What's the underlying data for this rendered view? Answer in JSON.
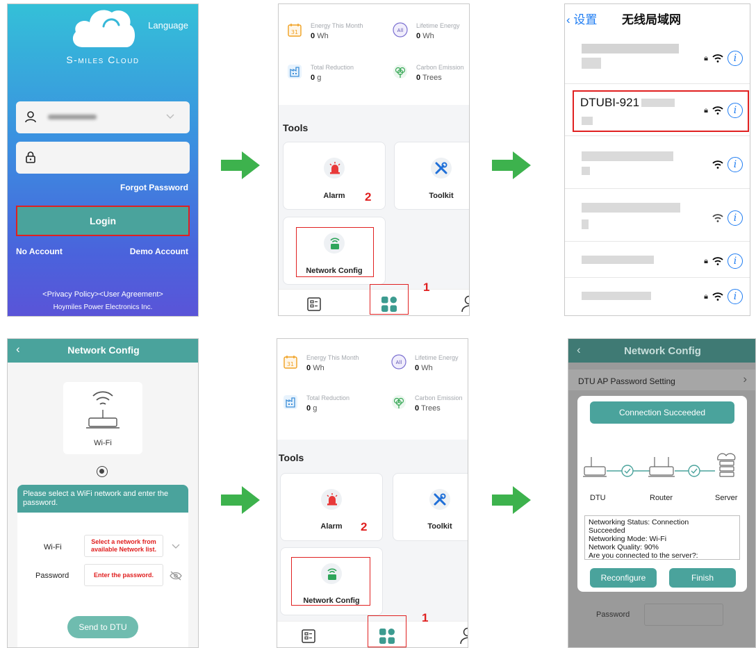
{
  "login": {
    "language": "Language",
    "brand": "S-miles Cloud",
    "forgot": "Forgot Password",
    "login_button": "Login",
    "no_account": "No Account",
    "demo_account": "Demo Account",
    "privacy": "<Privacy Policy><User Agreement>",
    "company": "Hoymiles Power Electronics Inc."
  },
  "tools": {
    "energy_month_label": "Energy This Month",
    "energy_month_value": "0",
    "energy_month_unit": "Wh",
    "lifetime_label": "Lifetime Energy",
    "lifetime_value": "0",
    "lifetime_unit": "Wh",
    "reduction_label": "Total Reduction",
    "reduction_value": "0",
    "reduction_unit": "g",
    "carbon_label": "Carbon Emission",
    "carbon_value": "0",
    "carbon_unit": "Trees",
    "calendar_day": "31",
    "all_badge": "All",
    "tools_title": "Tools",
    "alarm": "Alarm",
    "toolkit": "Toolkit",
    "network_config": "Network Config",
    "step1": "1",
    "step2": "2"
  },
  "wifi": {
    "back": "设置",
    "title": "无线局域网",
    "dtu_name": "DTUBI-921",
    "info_glyph": "i"
  },
  "netcfg": {
    "title": "Network Config",
    "wifi_label": "Wi-Fi",
    "instruction": "Please select a WiFi network and enter the password.",
    "field_wifi": "Wi-Fi",
    "field_wifi_value": "Select a network from available Network list.",
    "field_password": "Password",
    "field_password_value": "Enter the password.",
    "send": "Send to DTU"
  },
  "success": {
    "title": "Network Config",
    "setting_row": "DTU AP Password Setting",
    "connection_succeeded": "Connection Succeeded",
    "dtu": "DTU",
    "router": "Router",
    "server": "Server",
    "status_lines": [
      "Networking Status: Connection",
      "Succeeded",
      "Networking Mode: Wi-Fi",
      "Network Quality: 90%",
      "Are you connected to the server?:"
    ],
    "reconfigure": "Reconfigure",
    "finish": "Finish",
    "password_label": "Password"
  },
  "colors": {
    "teal": "#4aa39c",
    "step_red": "#e02020",
    "arrow_green": "#3db24d",
    "ios_blue": "#1e7cf2"
  }
}
